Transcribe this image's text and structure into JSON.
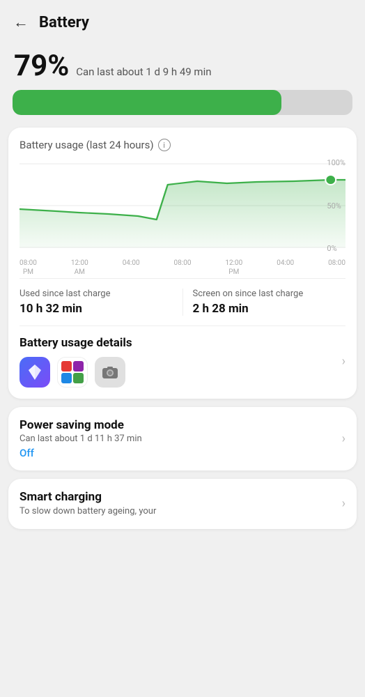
{
  "header": {
    "back_label": "←",
    "title": "Battery"
  },
  "battery": {
    "percent": "79%",
    "description": "Can last about 1 d 9 h 49 min",
    "fill_percent": 79,
    "bar_colors": {
      "fill": "#3db04a",
      "track": "#d5d5d5"
    }
  },
  "usage_card": {
    "section_title": "Battery usage (last 24 hours)",
    "info_icon_label": "i",
    "chart": {
      "y_labels": [
        "100%",
        "50%",
        "0%"
      ],
      "x_labels": [
        {
          "line1": "08:00",
          "line2": "PM"
        },
        {
          "line1": "12:00",
          "line2": "AM"
        },
        {
          "line1": "04:00",
          "line2": ""
        },
        {
          "line1": "08:00",
          "line2": ""
        },
        {
          "line1": "12:00",
          "line2": "PM"
        },
        {
          "line1": "04:00",
          "line2": ""
        },
        {
          "line1": "08:00",
          "line2": ""
        }
      ]
    },
    "stat1_label": "Used since last charge",
    "stat1_value": "10 h 32 min",
    "stat2_label": "Screen on since last charge",
    "stat2_value": "2 h 28 min",
    "details_heading": "Battery usage details",
    "chevron": "›"
  },
  "power_card": {
    "title": "Power saving mode",
    "description": "Can last about 1 d 11 h 37 min",
    "status": "Off",
    "chevron": "›"
  },
  "smart_card": {
    "title": "Smart charging",
    "description": "To slow down battery ageing, your"
  }
}
